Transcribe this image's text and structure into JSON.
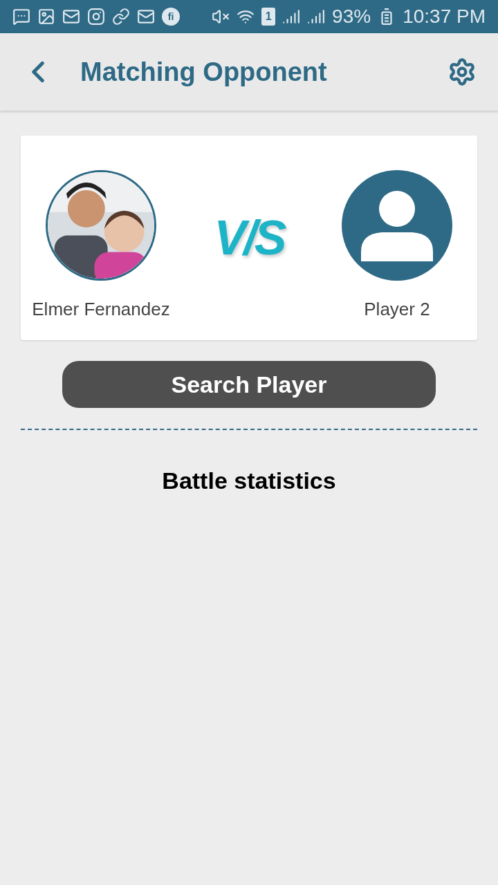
{
  "status_bar": {
    "sim_label": "1",
    "app_label": "fi",
    "battery": "93%",
    "time": "10:37 PM"
  },
  "header": {
    "title": "Matching Opponent"
  },
  "match": {
    "player_1": {
      "name": "Elmer Fernandez",
      "kind": "picture"
    },
    "vs": "V/S",
    "player_2": {
      "name": "Player 2",
      "kind": "placeholder"
    }
  },
  "search_button": "Search Player",
  "section_title": "Battle statistics"
}
